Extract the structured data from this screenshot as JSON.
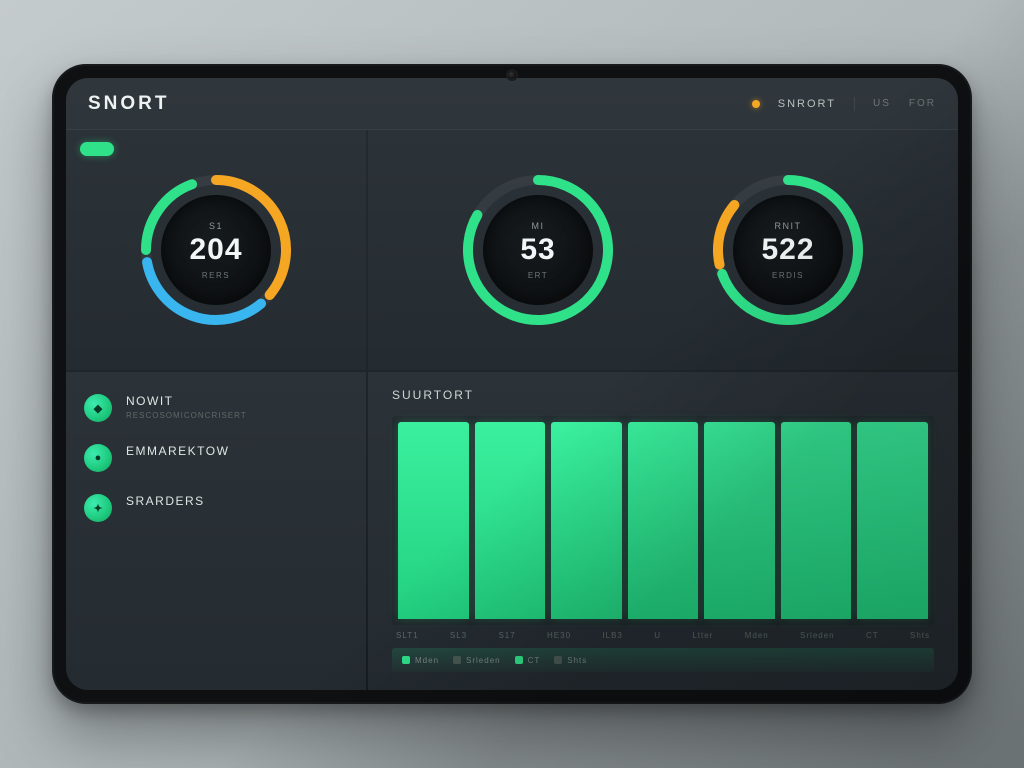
{
  "colors": {
    "accent_green": "#2fe28a",
    "accent_orange": "#f5a623",
    "accent_blue": "#39b6ef"
  },
  "header": {
    "brand": "SNORT",
    "nav": [
      {
        "label": "SNRORT"
      },
      {
        "label": "US"
      },
      {
        "label": "For"
      }
    ]
  },
  "gauges": {
    "g1": {
      "top": "S1",
      "value": "204",
      "bottom": "RERS",
      "ring": [
        {
          "color": "#f5a623",
          "from": 0,
          "to": 130
        },
        {
          "color": "#39b6ef",
          "from": 140,
          "to": 260
        },
        {
          "color": "#2fe28a",
          "from": 270,
          "to": 340
        }
      ]
    },
    "g2": {
      "top": "MI",
      "value": "53",
      "bottom": "ERT",
      "ring": [
        {
          "color": "#2fe28a",
          "from": 0,
          "to": 300
        }
      ]
    },
    "g3": {
      "top": "RNIT",
      "value": "522",
      "bottom": "ERDIS",
      "ring": [
        {
          "color": "#2fe28a",
          "from": 0,
          "to": 250
        },
        {
          "color": "#f5a623",
          "from": 258,
          "to": 310
        }
      ]
    }
  },
  "sidebar": {
    "items": [
      {
        "title": "NOWIT",
        "sub": "RESCOSOMICONCRISERT"
      },
      {
        "title": "Emmarektow",
        "sub": ""
      },
      {
        "title": "SRARDERS",
        "sub": ""
      }
    ]
  },
  "chart": {
    "title": "suurtort",
    "axis": [
      "SLT1",
      "SL3",
      "S17",
      "HE30",
      "ILB3",
      "U",
      "Ltter",
      "Mden",
      "Srleden",
      "CT",
      "Shts"
    ],
    "legend": [
      "Mden",
      "Srleden",
      "CT",
      "Shts"
    ]
  },
  "chart_data": {
    "type": "bar",
    "categories": [
      "SLT1",
      "SL3",
      "S17",
      "HE30",
      "ILB3",
      "U",
      "Ltter"
    ],
    "values": [
      100,
      100,
      100,
      100,
      100,
      100,
      100
    ],
    "title": "suurtort",
    "xlabel": "",
    "ylabel": "",
    "ylim": [
      0,
      100
    ]
  }
}
